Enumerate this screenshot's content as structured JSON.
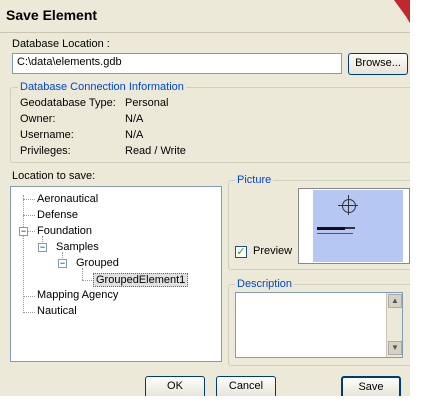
{
  "window": {
    "title": "Save Element"
  },
  "database": {
    "label": "Database Location :",
    "path": "C:\\data\\elements.gdb",
    "browse_label": "Browse..."
  },
  "connection": {
    "legend": "Database Connection Information",
    "rows": [
      {
        "key": "Geodatabase Type:",
        "value": "Personal"
      },
      {
        "key": "Owner:",
        "value": "N/A"
      },
      {
        "key": "Username:",
        "value": "N/A"
      },
      {
        "key": "Privileges:",
        "value": "Read / Write"
      }
    ]
  },
  "location": {
    "label": "Location to save:",
    "tree": [
      {
        "label": "Aeronautical"
      },
      {
        "label": "Defense"
      },
      {
        "label": "Foundation",
        "expander": "−"
      },
      {
        "label": "Samples",
        "expander": "−"
      },
      {
        "label": "Grouped",
        "expander": "−"
      },
      {
        "label": "GroupedElement1",
        "selected": true
      },
      {
        "label": "Mapping Agency"
      },
      {
        "label": "Nautical"
      }
    ]
  },
  "picture": {
    "legend": "Picture",
    "preview_label": "Preview",
    "preview_checked": true,
    "accent": "#b7c7f3"
  },
  "description": {
    "legend": "Description",
    "value": ""
  },
  "buttons": {
    "ok": "OK",
    "cancel": "Cancel",
    "save": "Save"
  }
}
